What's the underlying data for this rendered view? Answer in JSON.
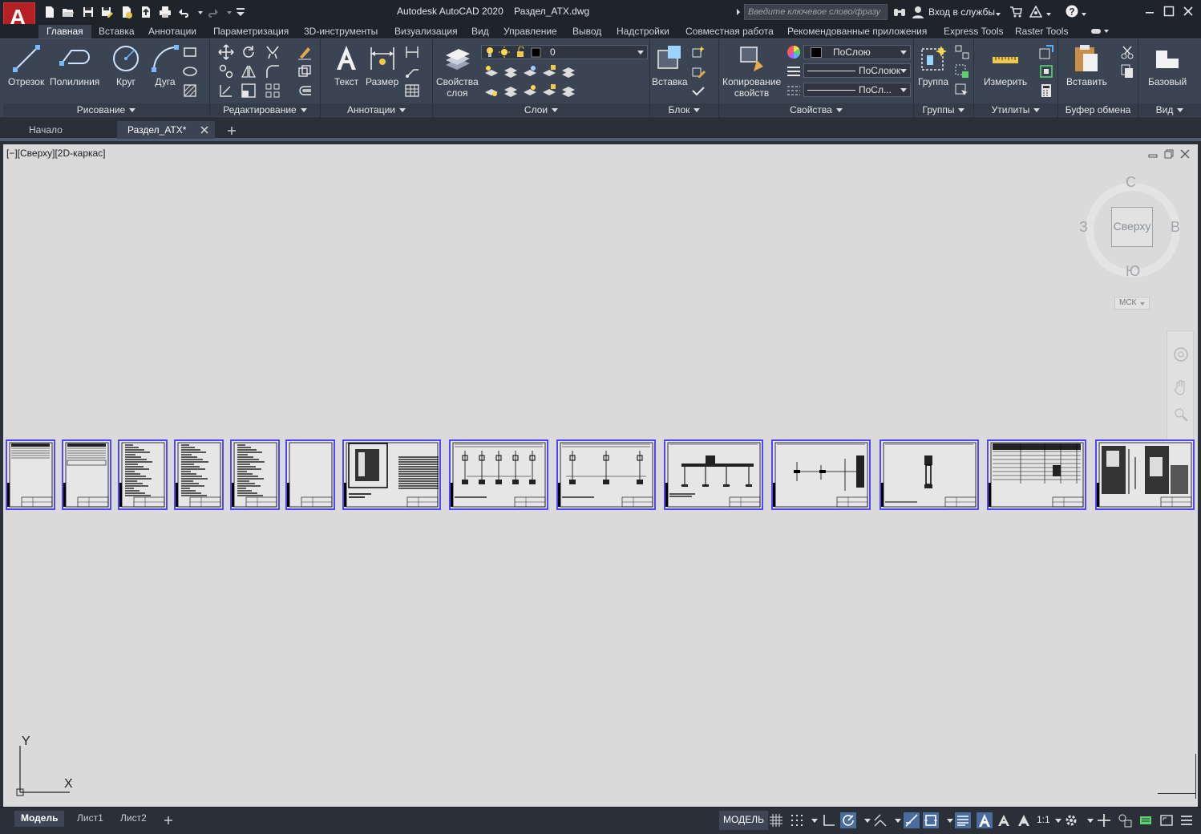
{
  "app": {
    "logo_letter": "A",
    "title": "Autodesk AutoCAD 2020    Раздел_АТХ.dwg",
    "search_placeholder": "Введите ключевое слово/фразу",
    "signin_label": "Вход в службы",
    "help_label": "?"
  },
  "quick_access": [
    "new-icon",
    "open-icon",
    "save-icon",
    "save-as-icon",
    "open-from-web-icon",
    "save-to-web-icon",
    "plot-icon",
    "undo-icon",
    "redo-icon",
    "customize-icon"
  ],
  "ribbon_tabs": [
    {
      "label": "Главная",
      "active": true
    },
    {
      "label": "Вставка"
    },
    {
      "label": "Аннотации"
    },
    {
      "label": "Параметризация"
    },
    {
      "label": "3D-инструменты"
    },
    {
      "label": "Визуализация"
    },
    {
      "label": "Вид"
    },
    {
      "label": "Управление"
    },
    {
      "label": "Вывод"
    },
    {
      "label": "Надстройки"
    },
    {
      "label": "Совместная работа"
    },
    {
      "label": "Рекомендованные приложения"
    },
    {
      "label": "Express Tools"
    },
    {
      "label": "Raster Tools"
    }
  ],
  "ribbon": {
    "draw": {
      "title": "Рисование",
      "line": "Отрезок",
      "polyline": "Полилиния",
      "circle": "Круг",
      "arc": "Дуга"
    },
    "modify": {
      "title": "Редактирование"
    },
    "annotation": {
      "title": "Аннотации",
      "text": "Текст",
      "dimension": "Размер"
    },
    "layers": {
      "title": "Слои",
      "layer_props_1": "Свойства",
      "layer_props_2": "слоя",
      "current_layer": "0"
    },
    "block": {
      "title": "Блок",
      "insert": "Вставка"
    },
    "properties": {
      "title": "Свойства",
      "match_1": "Копирование",
      "match_2": "свойств",
      "color": "ПоСлою",
      "linetype": "ПоСлоюк",
      "lineweight": "ПоСл..."
    },
    "groups": {
      "title": "Группы",
      "group": "Группа"
    },
    "utilities": {
      "title": "Утилиты",
      "measure": "Измерить"
    },
    "clipboard": {
      "title": "Буфер обмена",
      "paste": "Вставить"
    },
    "view": {
      "title": "Вид",
      "base": "Базовый"
    }
  },
  "file_tabs": [
    {
      "label": "Начало"
    },
    {
      "label": "Раздел_АТХ*",
      "active": true
    }
  ],
  "viewport": {
    "label": "[−][Сверху][2D-каркас]",
    "viewcube": {
      "face": "Сверху",
      "north": "С",
      "south": "Ю",
      "east": "В",
      "west": "З",
      "ucs": "МСК"
    },
    "ucs_x": "X",
    "ucs_y": "Y"
  },
  "sheets": [
    "text-sheet",
    "table-sheet",
    "spec-sheet",
    "spec-sheet",
    "spec-sheet",
    "blank-sheet",
    "panel-drawing",
    "schematic-5",
    "schematic-3",
    "bus-diagram",
    "wiring-diagram",
    "device-drawing",
    "table-drawing",
    "plan-drawing"
  ],
  "layout_tabs": [
    {
      "label": "Модель",
      "active": true
    },
    {
      "label": "Лист1"
    },
    {
      "label": "Лист2"
    }
  ],
  "status": {
    "model_label": "МОДЕЛЬ",
    "scale_label": "1:1"
  }
}
